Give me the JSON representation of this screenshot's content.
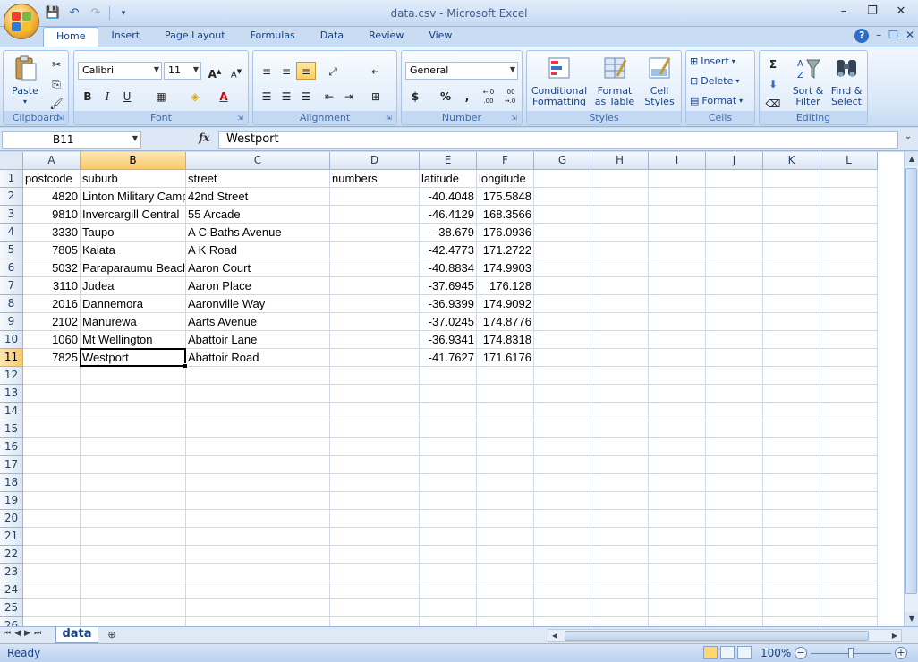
{
  "window": {
    "title": "data.csv - Microsoft Excel",
    "minimize": "–",
    "restore": "❐",
    "close": "✕"
  },
  "ribbon": {
    "tabs": [
      "Home",
      "Insert",
      "Page Layout",
      "Formulas",
      "Data",
      "Review",
      "View"
    ],
    "active_tab": "Home",
    "clipboard": {
      "paste": "Paste",
      "label": "Clipboard"
    },
    "font": {
      "name": "Calibri",
      "size": "11",
      "label": "Font",
      "bold": "B",
      "italic": "I",
      "underline": "U"
    },
    "alignment": {
      "label": "Alignment"
    },
    "number": {
      "format": "General",
      "currency": "$",
      "percent": "%",
      "comma": ",",
      "inc_decimal": "←.0 .00",
      "dec_decimal": ".00 →.0",
      "label": "Number"
    },
    "styles": {
      "conditional_1": "Conditional",
      "conditional_2": "Formatting",
      "format_table_1": "Format",
      "format_table_2": "as Table",
      "cell_styles_1": "Cell",
      "cell_styles_2": "Styles",
      "label": "Styles"
    },
    "cells": {
      "insert": "Insert",
      "delete": "Delete",
      "format": "Format",
      "label": "Cells"
    },
    "editing": {
      "sigma": "Σ",
      "sort_1": "Sort &",
      "sort_2": "Filter",
      "find_1": "Find &",
      "find_2": "Select",
      "label": "Editing"
    }
  },
  "formula_bar": {
    "name_box": "B11",
    "fx": "fx",
    "value": "Westport"
  },
  "columns": [
    {
      "key": "A",
      "width": 64
    },
    {
      "key": "B",
      "width": 118
    },
    {
      "key": "C",
      "width": 161
    },
    {
      "key": "D",
      "width": 100
    },
    {
      "key": "E",
      "width": 64
    },
    {
      "key": "F",
      "width": 64
    },
    {
      "key": "G",
      "width": 64
    },
    {
      "key": "H",
      "width": 64
    },
    {
      "key": "I",
      "width": 64
    },
    {
      "key": "J",
      "width": 64
    },
    {
      "key": "K",
      "width": 64
    },
    {
      "key": "L",
      "width": 64
    }
  ],
  "row_numbers": [
    "1",
    "2",
    "3",
    "4",
    "5",
    "6",
    "7",
    "8",
    "9",
    "10",
    "11",
    "12",
    "13",
    "14",
    "15",
    "16",
    "17",
    "18",
    "19",
    "20",
    "21",
    "22",
    "23",
    "24",
    "25",
    "26"
  ],
  "selection": {
    "column": "B",
    "row": "11"
  },
  "sheet_rows": [
    [
      "postcode",
      "suburb",
      "street",
      "numbers",
      "latitude",
      "longitude"
    ],
    [
      "4820",
      "Linton Military Camp",
      "42nd Street",
      "",
      "-40.4048",
      "175.5848"
    ],
    [
      "9810",
      "Invercargill Central",
      "55 Arcade",
      "",
      "-46.4129",
      "168.3566"
    ],
    [
      "3330",
      "Taupo",
      "A C Baths Avenue",
      "",
      "-38.679",
      "176.0936"
    ],
    [
      "7805",
      "Kaiata",
      "A K Road",
      "",
      "-42.4773",
      "171.2722"
    ],
    [
      "5032",
      "Paraparaumu Beach",
      "Aaron Court",
      "",
      "-40.8834",
      "174.9903"
    ],
    [
      "3110",
      "Judea",
      "Aaron Place",
      "",
      "-37.6945",
      "176.128"
    ],
    [
      "2016",
      "Dannemora",
      "Aaronville Way",
      "",
      "-36.9399",
      "174.9092"
    ],
    [
      "2102",
      "Manurewa",
      "Aarts Avenue",
      "",
      "-37.0245",
      "174.8776"
    ],
    [
      "1060",
      "Mt Wellington",
      "Abattoir Lane",
      "",
      "-36.9341",
      "174.8318"
    ],
    [
      "7825",
      "Westport",
      "Abattoir Road",
      "",
      "-41.7627",
      "171.6176"
    ]
  ],
  "sheets": [
    "data"
  ],
  "status": {
    "text": "Ready",
    "zoom": "100%"
  }
}
